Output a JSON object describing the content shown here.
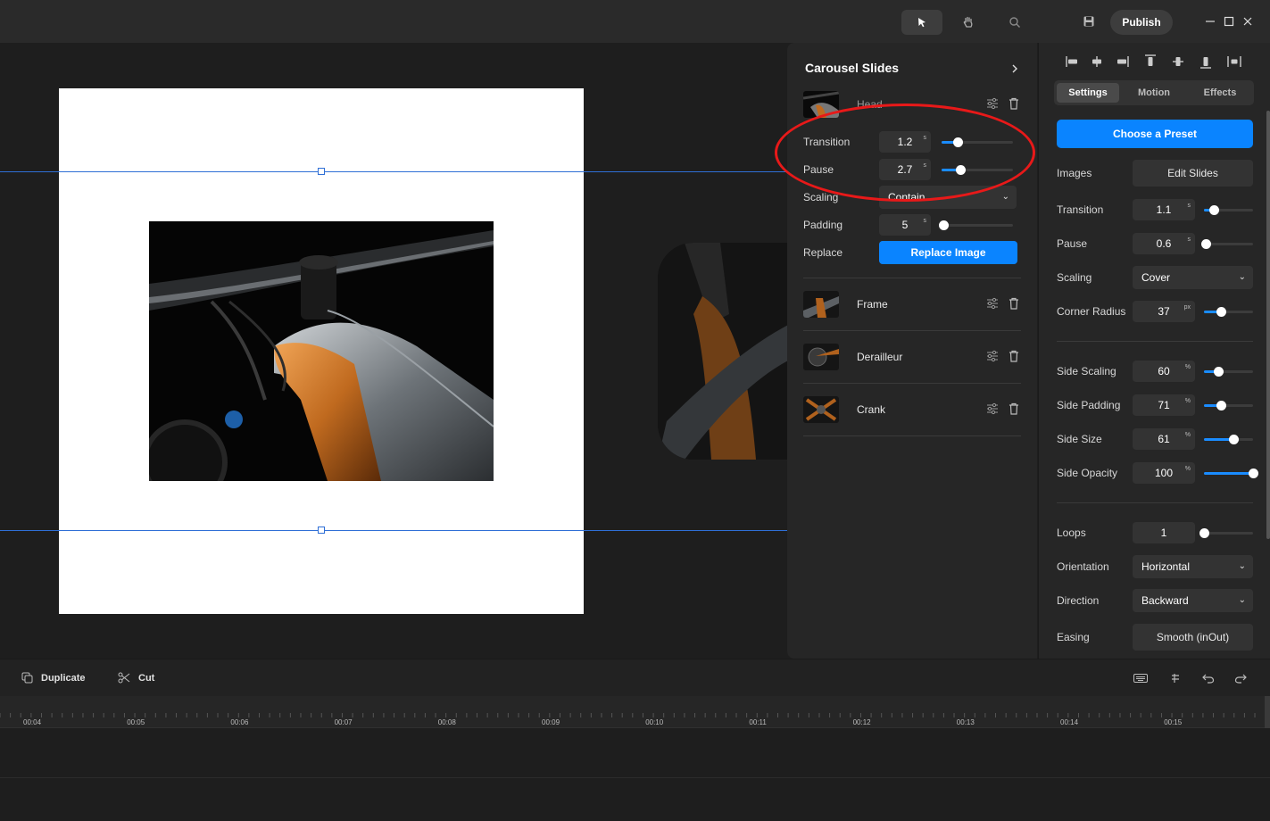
{
  "toolbar_top": {
    "tools": [
      "select-icon",
      "hand-icon",
      "search-icon"
    ],
    "save_icon": "save-icon",
    "publish_label": "Publish"
  },
  "window_controls": [
    "minimize-icon",
    "maximize-icon",
    "close-icon"
  ],
  "carousel_panel": {
    "title": "Carousel Slides",
    "slides": [
      {
        "name": "Head",
        "expanded": true
      },
      {
        "name": "Frame"
      },
      {
        "name": "Derailleur"
      },
      {
        "name": "Crank"
      }
    ],
    "head_settings": {
      "transition_label": "Transition",
      "transition_value": "1.2",
      "transition_unit": "s",
      "transition_level": 0.23,
      "pause_label": "Pause",
      "pause_value": "2.7",
      "pause_unit": "s",
      "pause_level": 0.26,
      "scaling_label": "Scaling",
      "scaling_value": "Contain",
      "padding_label": "Padding",
      "padding_value": "5",
      "padding_unit": "s",
      "padding_level": 0.03,
      "replace_label": "Replace",
      "replace_button": "Replace Image"
    }
  },
  "settings_panel": {
    "tabs": [
      "Settings",
      "Motion",
      "Effects"
    ],
    "active_tab": "Settings",
    "preset_button": "Choose a Preset",
    "images_label": "Images",
    "edit_slides_button": "Edit Slides",
    "transition_label": "Transition",
    "transition_value": "1.1",
    "transition_unit": "s",
    "transition_level": 0.2,
    "pause_label": "Pause",
    "pause_value": "0.6",
    "pause_unit": "s",
    "pause_level": 0.03,
    "scaling_label": "Scaling",
    "scaling_value": "Cover",
    "corner_radius_label": "Corner Radius",
    "corner_radius_value": "37",
    "corner_radius_unit": "px",
    "corner_radius_level": 0.35,
    "side_scaling_label": "Side Scaling",
    "side_scaling_value": "60",
    "side_scaling_unit": "%",
    "side_scaling_level": 0.29,
    "side_padding_label": "Side Padding",
    "side_padding_value": "71",
    "side_padding_unit": "%",
    "side_padding_level": 0.35,
    "side_size_label": "Side Size",
    "side_size_value": "61",
    "side_size_unit": "%",
    "side_size_level": 0.6,
    "side_opacity_label": "Side Opacity",
    "side_opacity_value": "100",
    "side_opacity_unit": "%",
    "side_opacity_level": 1.0,
    "loops_label": "Loops",
    "loops_value": "1",
    "loops_level": 0.0,
    "orientation_label": "Orientation",
    "orientation_value": "Horizontal",
    "direction_label": "Direction",
    "direction_value": "Backward",
    "easing_label": "Easing",
    "easing_value": "Smooth (inOut)"
  },
  "bottom_toolbar": {
    "duplicate_label": "Duplicate",
    "cut_label": "Cut",
    "right_icons": [
      "keyboard-icon",
      "split-icon",
      "undo-icon",
      "redo-icon"
    ]
  },
  "timeline": {
    "ticks": [
      "00:04",
      "00:05",
      "00:06",
      "00:07",
      "00:08",
      "00:09",
      "00:10",
      "00:11",
      "00:12",
      "00:13",
      "00:14",
      "00:15"
    ]
  },
  "colors": {
    "accent": "#0a84ff",
    "annotation": "#e81919",
    "guide": "#2f6fd6"
  }
}
